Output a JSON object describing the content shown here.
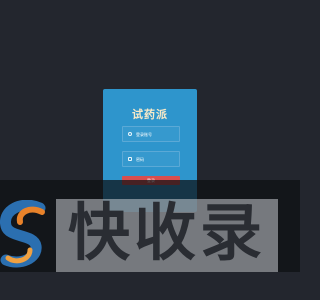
{
  "login": {
    "title": "试药派",
    "account_placeholder": "登录账号",
    "password_placeholder": "密码",
    "submit_label": "登录"
  },
  "watermark": {
    "text": "快收录"
  },
  "colors": {
    "page_background": "#23262e",
    "card": "#2e95cc",
    "title": "#f7e9c8",
    "button": "#d94e4e"
  },
  "icons": {
    "account": "user-icon",
    "password": "lock-icon"
  }
}
